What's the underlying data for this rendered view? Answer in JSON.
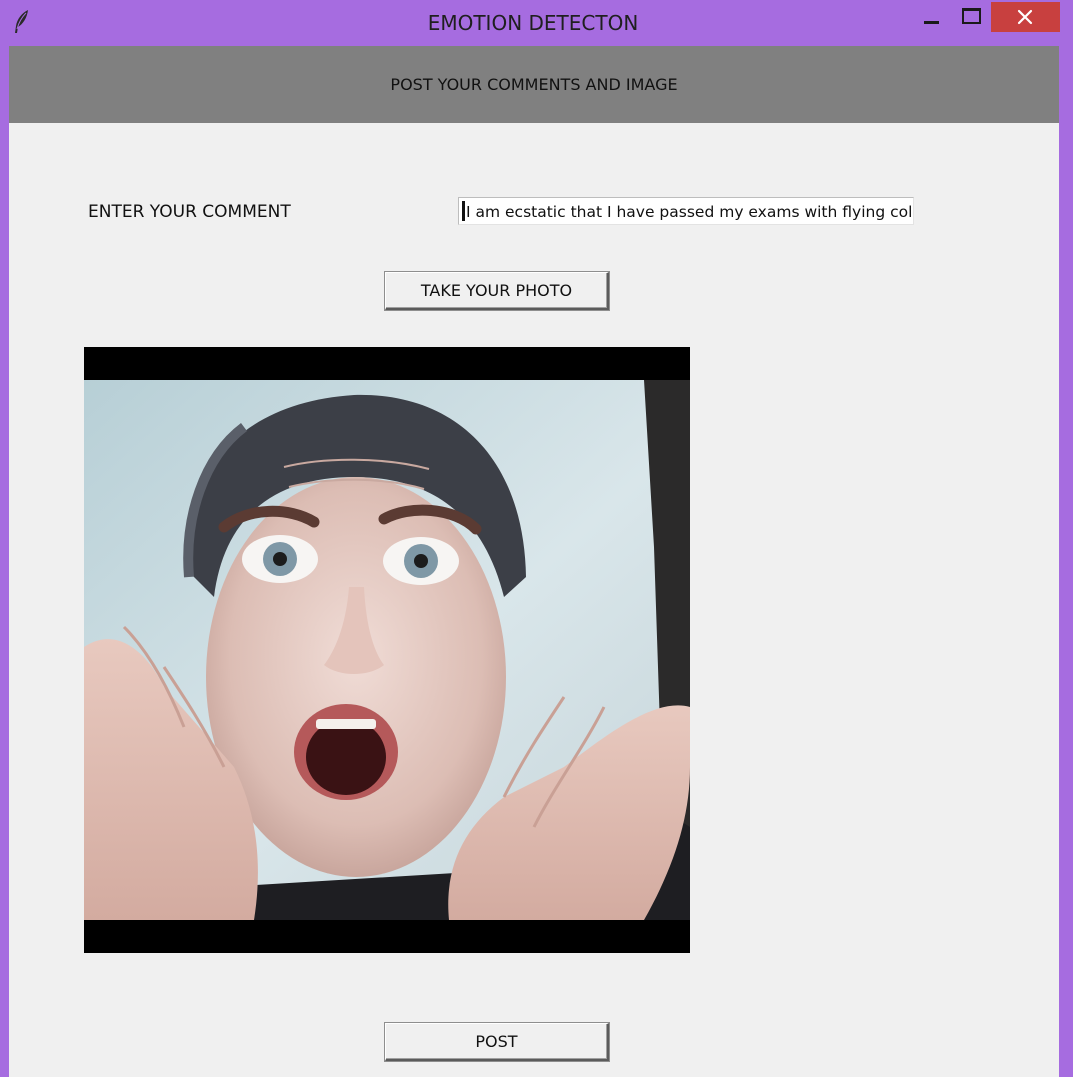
{
  "window": {
    "title": "EMOTION DETECTON",
    "frame_color": "#a66ce0",
    "close_color": "#c8403f"
  },
  "header": {
    "text": "POST YOUR COMMENTS AND IMAGE",
    "background": "#808080"
  },
  "form": {
    "comment_label": "ENTER YOUR COMMENT",
    "comment_value": "I am ecstatic that I have passed my exams with flying colc",
    "take_photo_label": "TAKE YOUR PHOTO",
    "post_label": "POST"
  },
  "photo": {
    "icon": "captured-photo",
    "subject": "surprised face"
  },
  "icons": {
    "app": "feather-icon",
    "minimize": "minimize-icon",
    "maximize": "maximize-icon",
    "close": "close-icon"
  }
}
